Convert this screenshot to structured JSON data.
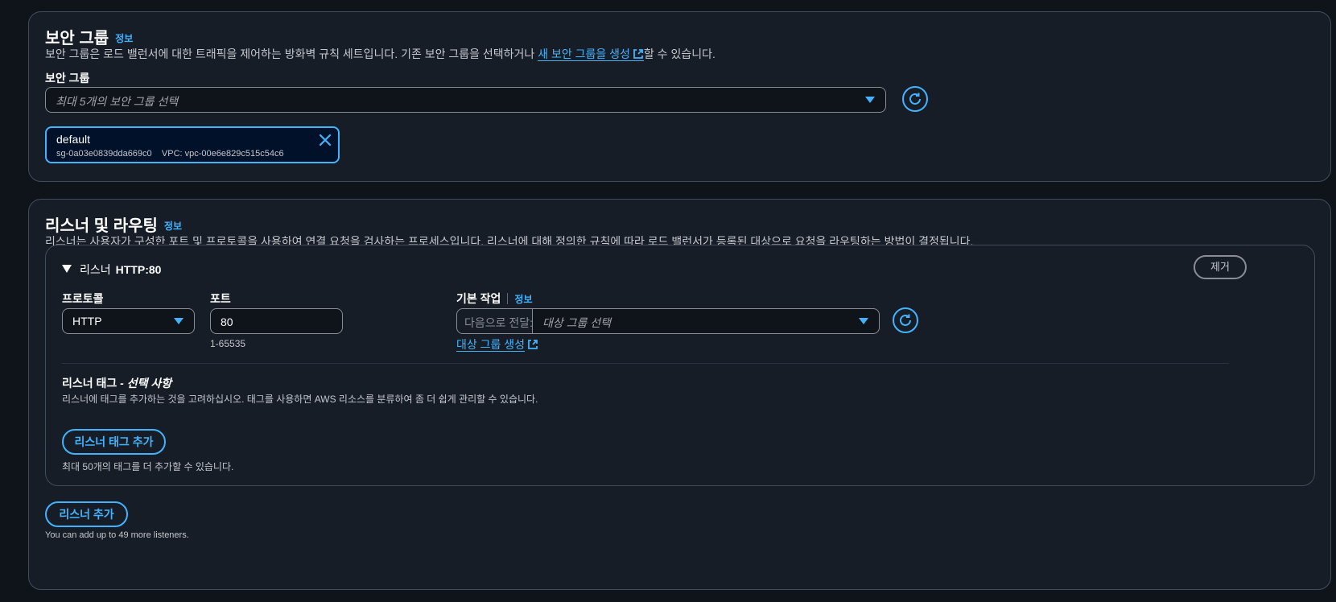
{
  "security_group_section": {
    "title": "보안 그룹",
    "info": "정보",
    "description_before": "보안 그룹은 로드 밸런서에 대한 트래픽을 제어하는 방화벽 규칙 세트입니다. 기존 보안 그룹을 선택하거나 ",
    "description_link": "새 보안 그룹을 생성",
    "description_after": "할 수 있습니다.",
    "field_label": "보안 그룹",
    "select_placeholder": "최대 5개의 보안 그룹 선택",
    "selected_token": {
      "name": "default",
      "sg_id": "sg-0a03e0839dda669c0",
      "vpc": "VPC: vpc-00e6e829c515c54c6"
    }
  },
  "listeners_section": {
    "title": "리스너 및 라우팅",
    "info": "정보",
    "description": "리스너는 사용자가 구성한 포트 및 프로토콜을 사용하여 연결 요청을 검사하는 프로세스입니다. 리스너에 대해 정의한 규칙에 따라 로드 밸런서가 등록된 대상으로 요청을 라우팅하는 방법이 결정됩니다.",
    "listener": {
      "expander_label": "리스너",
      "expander_value": "HTTP:80",
      "remove_button": "제거",
      "protocol_label": "프로토콜",
      "protocol_value": "HTTP",
      "port_label": "포트",
      "port_value": "80",
      "port_hint": "1-65535",
      "default_action_label": "기본 작업",
      "default_action_info": "정보",
      "forward_prefix": "다음으로 전달:",
      "target_group_placeholder": "대상 그룹 선택",
      "create_target_group_link": "대상 그룹 생성",
      "tags_title": "리스너 태그 - ",
      "tags_title_optional": "선택 사항",
      "tags_description": "리스너에 태그를 추가하는 것을 고려하십시오. 태그를 사용하면 AWS 리소스를 분류하여 좀 더 쉽게 관리할 수 있습니다.",
      "add_tag_button": "리스너 태그 추가",
      "tag_limit_hint": "최대 50개의 태그를 더 추가할 수 있습니다."
    },
    "add_listener_button": "리스너 추가",
    "listener_limit_hint": "You can add up to 49 more listeners."
  },
  "colors": {
    "background": "#0f141a",
    "panel": "#161d26",
    "accent": "#42b4ff",
    "border": "#414d5c"
  },
  "icons": [
    "external-link-icon",
    "caret-down-icon",
    "refresh-icon",
    "close-icon",
    "expand-triangle-icon"
  ]
}
